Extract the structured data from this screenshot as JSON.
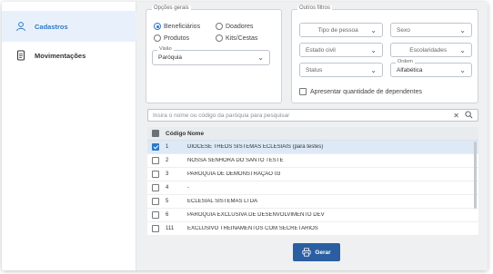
{
  "sidebar": {
    "items": [
      {
        "label": "Cadastros",
        "icon": "user-icon",
        "active": true
      },
      {
        "label": "Movimentações",
        "icon": "document-icon",
        "active": false
      }
    ]
  },
  "general_options": {
    "legend": "Opções gerais",
    "radios": [
      {
        "label": "Beneficiários",
        "checked": true
      },
      {
        "label": "Doadores",
        "checked": false
      },
      {
        "label": "Produtos",
        "checked": false
      },
      {
        "label": "Kits/Cestas",
        "checked": false
      }
    ],
    "view": {
      "legend": "Visão",
      "value": "Paróquia"
    }
  },
  "other_filters": {
    "legend": "Outros filtros",
    "selects": {
      "person_type": "Tipo de pessoa",
      "sex": "Sexo",
      "civil_status": "Estado civil",
      "schooling": "Escolaridades",
      "status": "Status",
      "order_legend": "Ordem",
      "order_value": "Alfabética"
    },
    "show_dependents": {
      "label": "Apresentar quantidade de dependentes",
      "checked": false
    }
  },
  "search": {
    "placeholder": "Insira o nome ou código da paróquia para pesquisar"
  },
  "table": {
    "headers": {
      "code": "Código",
      "name": "Nome"
    },
    "rows": [
      {
        "code": "1",
        "name": "DIOCESE THEOS SISTEMAS ECLESIAIS (para testes)",
        "checked": true
      },
      {
        "code": "2",
        "name": "NOSSA SENHORA DO SANTO TESTE",
        "checked": false
      },
      {
        "code": "3",
        "name": "PARÓQUIA DE DEMONSTRAÇÃO 03",
        "checked": false
      },
      {
        "code": "4",
        "name": "-",
        "checked": false
      },
      {
        "code": "5",
        "name": "ECLESIAL SISTEMAS LTDA",
        "checked": false
      },
      {
        "code": "6",
        "name": "PARÓQUIA EXCLUSIVA DE DESENVOLVIMENTO DEV",
        "checked": false
      },
      {
        "code": "111",
        "name": "EXCLUSIVO TREINAMENTOS COM SECRETÁRIOS",
        "checked": false
      }
    ]
  },
  "actions": {
    "generate_label": "Gerar"
  },
  "colors": {
    "accent": "#2f78c6",
    "button": "#2b5ea0",
    "selected_row": "#dde9f7"
  }
}
